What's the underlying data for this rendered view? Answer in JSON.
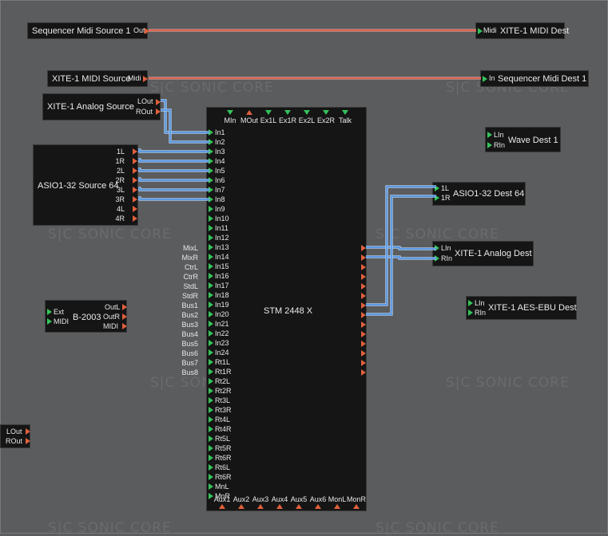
{
  "watermark": "S|C  SONIC CORE",
  "colors": {
    "background": "#5b5c5e",
    "module": "#151515",
    "input_port": "#35c25a",
    "output_port": "#e0603c",
    "audio_cable": "#4a8fe0",
    "midi_cable": "#e05a4a"
  },
  "modules": {
    "seq_midi_source": {
      "title": "Sequencer Midi Source 1",
      "out": "Out"
    },
    "xite_midi_dest": {
      "title": "XITE-1 MIDI Dest",
      "in": "Midi"
    },
    "xite_midi_source": {
      "title": "XITE-1 MIDI Source",
      "out": "Midi"
    },
    "seq_midi_dest": {
      "title": "Sequencer Midi Dest 1",
      "in": "In"
    },
    "xite_analog_source": {
      "title": "XITE-1 Analog Source",
      "outs": [
        "LOut",
        "ROut"
      ]
    },
    "asio_source": {
      "title": "ASIO1-32 Source 64",
      "outs": [
        "1L",
        "1R",
        "2L",
        "2R",
        "3L",
        "3R",
        "4L",
        "4R"
      ]
    },
    "wave_dest": {
      "title": "Wave Dest 1",
      "ins": [
        "LIn",
        "RIn"
      ]
    },
    "asio_dest": {
      "title": "ASIO1-32 Dest 64",
      "ins": [
        "1L",
        "1R"
      ]
    },
    "xite_analog_dest": {
      "title": "XITE-1 Analog Dest",
      "ins": [
        "LIn",
        "RIn"
      ]
    },
    "xite_aes_dest": {
      "title": "XITE-1 AES-EBU Dest",
      "ins": [
        "LIn",
        "RIn"
      ]
    },
    "b2003": {
      "title": "B-2003",
      "ins": [
        "Ext",
        "MIDI"
      ],
      "outs": [
        "OutL",
        "OutR",
        "MIDI"
      ]
    },
    "small_out": {
      "outs": [
        "LOut",
        "ROut"
      ]
    },
    "stm": {
      "title": "STM 2448 X",
      "top_ports": [
        "MIn",
        "MOut",
        "Ex1L",
        "Ex1R",
        "Ex2L",
        "Ex2R",
        "Talk"
      ],
      "inputs": [
        "In1",
        "In2",
        "In3",
        "In4",
        "In5",
        "In6",
        "In7",
        "In8",
        "In9",
        "In10",
        "In11",
        "In12",
        "In13",
        "In14",
        "In15",
        "In16",
        "In17",
        "In18",
        "In19",
        "In20",
        "In21",
        "In22",
        "In23",
        "In24",
        "Rt1L",
        "Rt1R",
        "Rt2L",
        "Rt2R",
        "Rt3L",
        "Rt3R",
        "Rt4L",
        "Rt4R",
        "Rt5L",
        "Rt5R",
        "Rt6R",
        "Rt6L",
        "Rt6R",
        "MnL",
        "MnR"
      ],
      "outputs": [
        "MixL",
        "MixR",
        "CtrL",
        "CtrR",
        "StdL",
        "StdR",
        "Bus1",
        "Bus2",
        "Bus3",
        "Bus4",
        "Bus5",
        "Bus6",
        "Bus7",
        "Bus8"
      ],
      "bottom_ports": [
        "Aux1",
        "Aux2",
        "Aux3",
        "Aux4",
        "Aux5",
        "Aux6",
        "MonL",
        "MonR"
      ]
    }
  }
}
